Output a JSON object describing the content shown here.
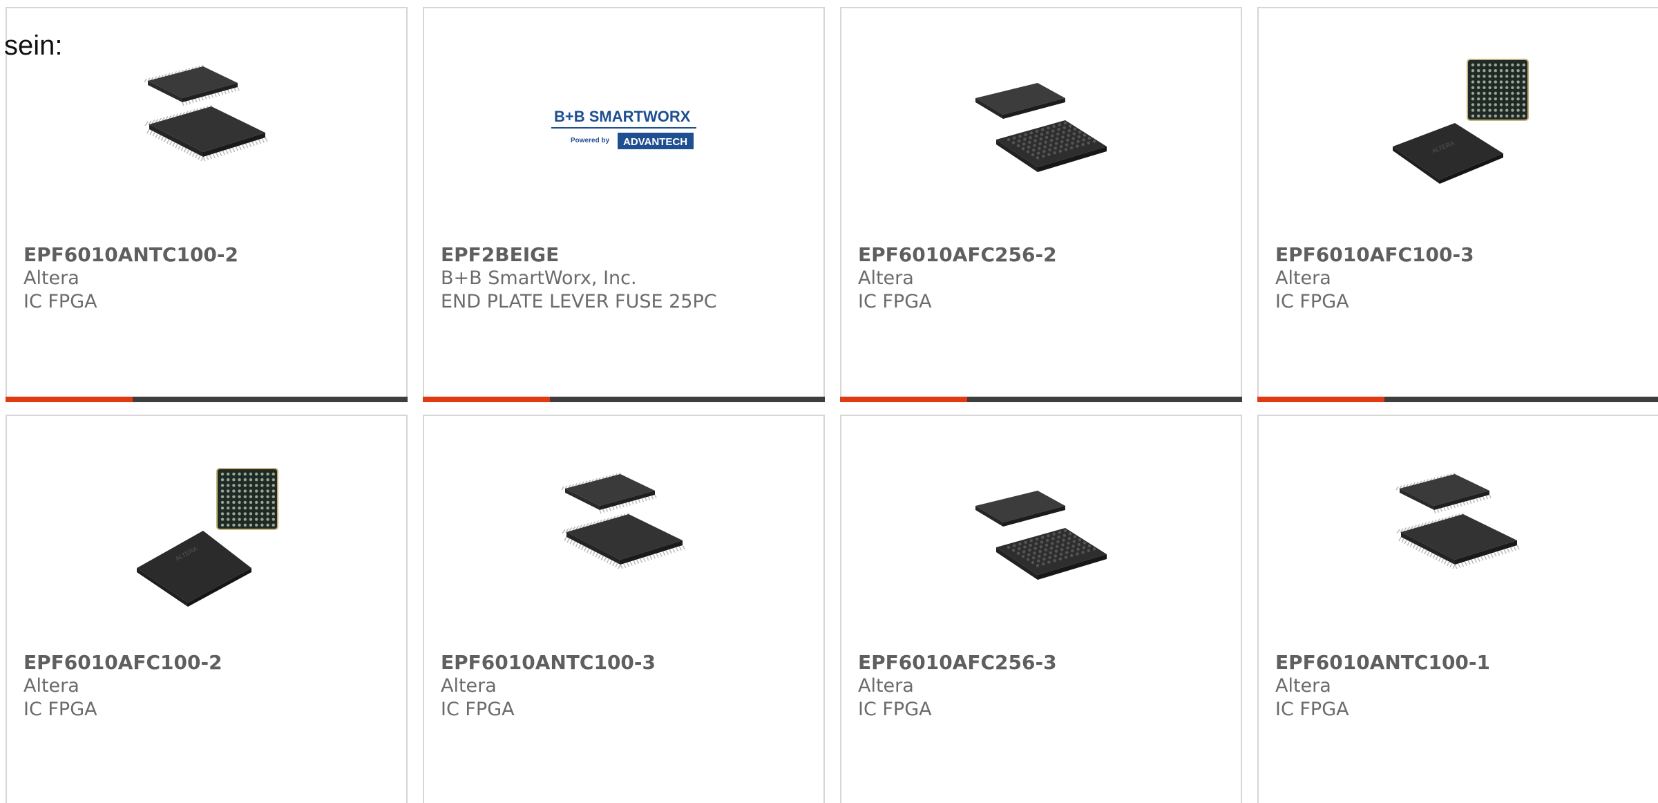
{
  "intro_text": "sein:",
  "colors": {
    "accent": "#e03a12",
    "bar_dark": "#3e3e3e",
    "card_border": "#d6d6d6",
    "part_text": "#5f5f5f",
    "meta_text": "#6b6b6b"
  },
  "products": [
    {
      "part": "EPF6010ANTC100-2",
      "manufacturer": "Altera",
      "description": "IC FPGA",
      "image": "tqfp-chip-icon"
    },
    {
      "part": "EPF2BEIGE",
      "manufacturer": "B+B SmartWorx, Inc.",
      "description": "END PLATE LEVER FUSE 25PC",
      "image": "bb-smartworx-logo",
      "logo": {
        "line1": "B+B SMARTWORX",
        "line2_prefix": "Powered by",
        "line2_brand": "ADVANTECH"
      }
    },
    {
      "part": "EPF6010AFC256-2",
      "manufacturer": "Altera",
      "description": "IC FPGA",
      "image": "bga-chip-icon"
    },
    {
      "part": "EPF6010AFC100-3",
      "manufacturer": "Altera",
      "description": "IC FPGA",
      "image": "fbga-chip-icon"
    },
    {
      "part": "EPF6010AFC100-2",
      "manufacturer": "Altera",
      "description": "IC FPGA",
      "image": "fbga-chip-icon"
    },
    {
      "part": "EPF6010ANTC100-3",
      "manufacturer": "Altera",
      "description": "IC FPGA",
      "image": "tqfp-chip-icon"
    },
    {
      "part": "EPF6010AFC256-3",
      "manufacturer": "Altera",
      "description": "IC FPGA",
      "image": "bga-chip-icon"
    },
    {
      "part": "EPF6010ANTC100-1",
      "manufacturer": "Altera",
      "description": "IC FPGA",
      "image": "tqfp-chip-icon"
    }
  ]
}
